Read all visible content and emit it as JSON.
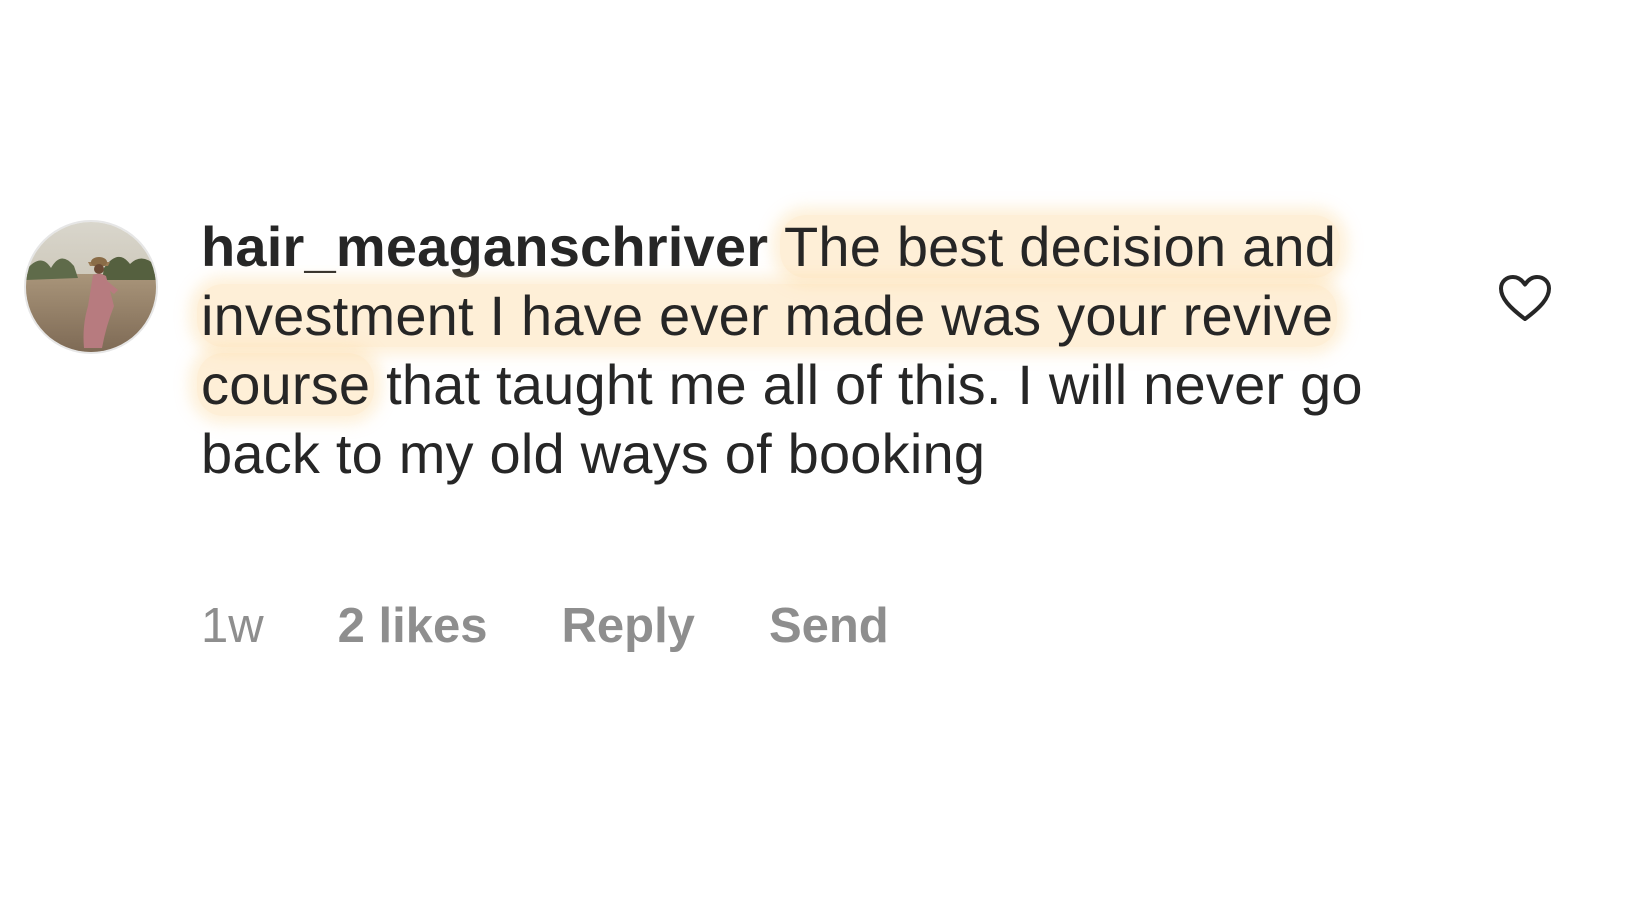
{
  "comment": {
    "username": "hair_meaganschriver",
    "highlighted_text": "The best decision and investment I have ever made was your revive course",
    "rest_text": "that taught me all of this. I will never go back to my old ways of booking",
    "time_ago": "1w",
    "likes": "2 likes",
    "reply_label": "Reply",
    "send_label": "Send",
    "like_icon": "heart-outline-icon"
  },
  "colors": {
    "text": "#262626",
    "meta": "#8e8e8e",
    "highlight": "#fdd696"
  }
}
